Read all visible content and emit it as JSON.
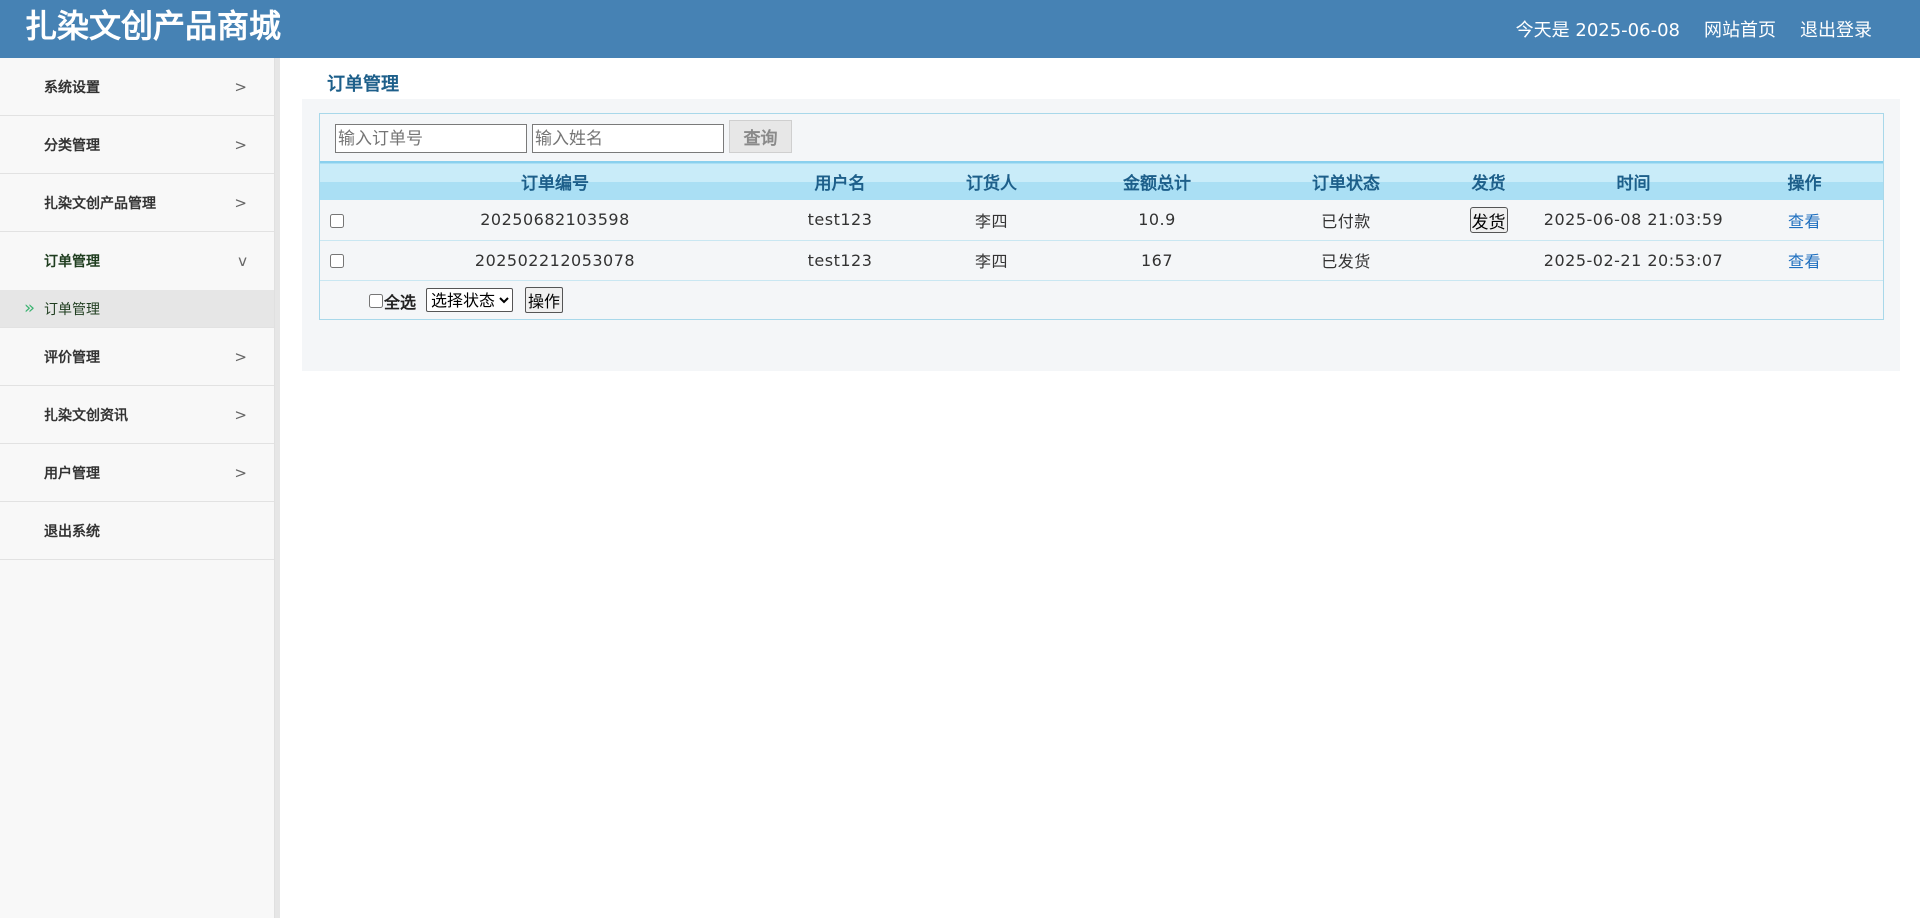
{
  "header": {
    "title": "扎染文创产品商城",
    "today": "今天是 2025-06-08",
    "home_link": "网站首页",
    "logout_link": "退出登录"
  },
  "sidebar": {
    "items": [
      {
        "label": "系统设置",
        "arrow": ">"
      },
      {
        "label": "分类管理",
        "arrow": ">"
      },
      {
        "label": "扎染文创产品管理",
        "arrow": ">"
      },
      {
        "label": "订单管理",
        "arrow": "v",
        "open": true
      },
      {
        "label": "评价管理",
        "arrow": ">"
      },
      {
        "label": "扎染文创资讯",
        "arrow": ">"
      },
      {
        "label": "用户管理",
        "arrow": ">"
      },
      {
        "label": "退出系统",
        "arrow": ""
      }
    ],
    "submenu": {
      "marker": "»",
      "label": "订单管理"
    }
  },
  "main": {
    "title": "订单管理",
    "search": {
      "order_placeholder": "输入订单号",
      "name_placeholder": "输入姓名",
      "query_label": "查询"
    },
    "table": {
      "columns": [
        "订单编号",
        "用户名",
        "订货人",
        "金额总计",
        "订单状态",
        "发货",
        "时间",
        "操作"
      ],
      "rows": [
        {
          "order_no": "20250682103598",
          "username": "test123",
          "orderer": "李四",
          "total": "10.9",
          "status": "已付款",
          "ship": "发货",
          "time": "2025-06-08 21:03:59",
          "action": "查看"
        },
        {
          "order_no": "202502212053078",
          "username": "test123",
          "orderer": "李四",
          "total": "167",
          "status": "已发货",
          "ship": "",
          "time": "2025-02-21 20:53:07",
          "action": "查看"
        }
      ]
    },
    "footer": {
      "select_all": "全选",
      "status_select": "选择状态",
      "operate_label": "操作"
    }
  },
  "colors": {
    "header_bg": "#4682b4",
    "accent_text": "#1d5f8a",
    "link": "#1e6fbf",
    "submenu_marker": "#3cb371"
  }
}
